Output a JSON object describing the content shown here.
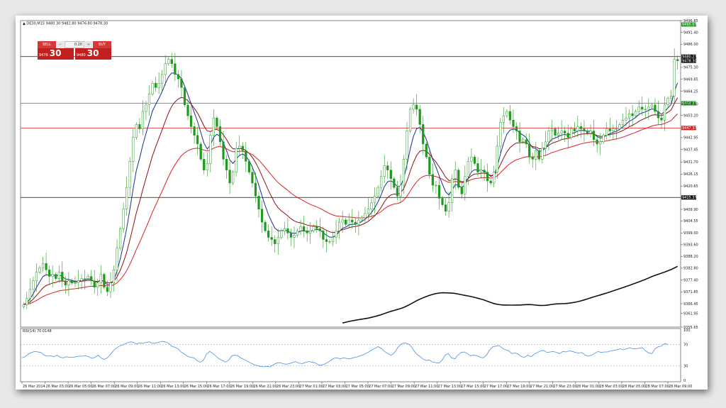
{
  "header": {
    "symbol_line": "▲ DE30,M15  9480.30 9482.80 9476.80 9478.30",
    "rsi_label": "RSI(14) 70.0148"
  },
  "trade_panel": {
    "sell_label": "SELL",
    "buy_label": "BUY",
    "lot_value": "0.20",
    "sell_price_small": "9478",
    "sell_price_big": "30",
    "buy_price_small": "9480",
    "buy_price_big": "30"
  },
  "colors": {
    "bull": "#1f9a1f",
    "bear": "#1f9a1f",
    "ma_fast": "#1a2c9c",
    "ma_mid": "#8b1010",
    "ma_slow": "#e02020",
    "ma_long": "#111111",
    "rsi": "#4a90e2"
  },
  "chart_data": {
    "type": "candlestick",
    "title": "DE30,M15",
    "ylim": [
      9355.65,
      9496.85
    ],
    "y_ticks": [
      "9496.85",
      "9491.40",
      "9486.00",
      "9475.30",
      "9469.85",
      "9464.25",
      "9458.30",
      "9453.20",
      "9442.95",
      "9437.45",
      "9431.70",
      "9426.15",
      "9420.65",
      "9409.90",
      "9404.55",
      "9399.00",
      "9393.60",
      "9388.20",
      "9382.80",
      "9377.40",
      "9371.85",
      "9366.45",
      "9361.95",
      "9355.65"
    ],
    "x_ticks": [
      "26 Mar 2014",
      "26 Mar 03:00",
      "26 Mar 05:00",
      "26 Mar 07:00",
      "26 Mar 09:00",
      "26 Mar 11:00",
      "26 Mar 13:00",
      "26 Mar 15:00",
      "26 Mar 17:00",
      "26 Mar 19:00",
      "26 Mar 21:00",
      "26 Mar 23:00",
      "27 Mar 01:00",
      "27 Mar 03:00",
      "27 Mar 05:00",
      "27 Mar 07:00",
      "27 Mar 09:00",
      "27 Mar 11:00",
      "27 Mar 13:00",
      "27 Mar 15:00",
      "27 Mar 17:00",
      "27 Mar 19:00",
      "27 Mar 21:00",
      "27 Mar 23:00",
      "28 Mar 01:00",
      "28 Mar 03:00",
      "28 Mar 05:00",
      "28 Mar 07:00",
      "28 Mar 09:00"
    ],
    "levels": [
      {
        "label": "9480.27",
        "value": 9480.27,
        "color": "#111111"
      },
      {
        "label": "9478.30",
        "value": 9478.3,
        "color": "#111111",
        "box_only": true
      },
      {
        "label": "9458.77",
        "value": 9458.77,
        "color": "#1f9a1f"
      },
      {
        "label": "9447.37",
        "value": 9447.37,
        "color": "#d42020"
      },
      {
        "label": "9415.37",
        "value": 9415.37,
        "color": "#111111"
      },
      {
        "label": "9495.07",
        "value": 9495.07,
        "color": "#1f9a1f",
        "box_only": true
      }
    ],
    "closes": [
      9366,
      9369,
      9373,
      9377,
      9381,
      9383,
      9385,
      9382,
      9379,
      9380,
      9378,
      9381,
      9377,
      9375,
      9377,
      9376,
      9376,
      9377,
      9378,
      9378,
      9379,
      9377,
      9374,
      9376,
      9380,
      9374,
      9372,
      9376,
      9382,
      9392,
      9401,
      9410,
      9420,
      9432,
      9443,
      9449,
      9447,
      9455,
      9458,
      9463,
      9468,
      9466,
      9468,
      9472,
      9477,
      9479,
      9477,
      9472,
      9470,
      9466,
      9458,
      9453,
      9448,
      9444,
      9440,
      9433,
      9428,
      9431,
      9444,
      9452,
      9448,
      9441,
      9433,
      9428,
      9422,
      9427,
      9438,
      9439,
      9437,
      9432,
      9427,
      9422,
      9416,
      9410,
      9404,
      9400,
      9397,
      9396,
      9394,
      9397,
      9400,
      9401,
      9399,
      9397,
      9398,
      9400,
      9402,
      9400,
      9399,
      9400,
      9402,
      9401,
      9400,
      9396,
      9395,
      9395,
      9397,
      9400,
      9404,
      9405,
      9403,
      9405,
      9404,
      9403,
      9405,
      9406,
      9408,
      9410,
      9413,
      9416,
      9420,
      9425,
      9430,
      9428,
      9424,
      9420,
      9416,
      9421,
      9433,
      9446,
      9456,
      9458,
      9456,
      9449,
      9440,
      9434,
      9426,
      9421,
      9421,
      9415,
      9412,
      9409,
      9413,
      9424,
      9428,
      9420,
      9417,
      9425,
      9432,
      9434,
      9431,
      9427,
      9428,
      9427,
      9423,
      9422,
      9427,
      9439,
      9450,
      9453,
      9455,
      9451,
      9448,
      9446,
      9441,
      9442,
      9440,
      9434,
      9433,
      9437,
      9433,
      9438,
      9441,
      9446,
      9447,
      9444,
      9445,
      9446,
      9445,
      9443,
      9447,
      9446,
      9448,
      9447,
      9446,
      9445,
      9446,
      9442,
      9440,
      9441,
      9444,
      9447,
      9446,
      9447,
      9447,
      9449,
      9451,
      9452,
      9454,
      9453,
      9455,
      9457,
      9456,
      9456,
      9457,
      9458,
      9455,
      9452,
      9451,
      9458,
      9461,
      9462,
      9479,
      9478.3
    ],
    "rsi": [
      45,
      47,
      52,
      55,
      57,
      56,
      55,
      50,
      48,
      49,
      47,
      50,
      46,
      45,
      47,
      46,
      46,
      47,
      48,
      48,
      49,
      47,
      44,
      46,
      50,
      44,
      42,
      46,
      53,
      60,
      65,
      68,
      70,
      73,
      75,
      74,
      71,
      73,
      72,
      74,
      75,
      72,
      73,
      74,
      76,
      75,
      73,
      67,
      65,
      62,
      56,
      52,
      48,
      46,
      45,
      40,
      37,
      40,
      52,
      57,
      53,
      48,
      43,
      40,
      37,
      41,
      49,
      50,
      48,
      44,
      41,
      38,
      35,
      32,
      30,
      29,
      28,
      29,
      28,
      32,
      35,
      36,
      34,
      33,
      34,
      36,
      38,
      35,
      34,
      36,
      38,
      37,
      36,
      32,
      31,
      33,
      36,
      40,
      44,
      45,
      43,
      45,
      44,
      43,
      45,
      46,
      48,
      50,
      53,
      56,
      60,
      63,
      66,
      62,
      57,
      53,
      50,
      54,
      63,
      70,
      73,
      72,
      69,
      60,
      52,
      48,
      43,
      40,
      41,
      37,
      36,
      35,
      40,
      50,
      53,
      45,
      43,
      50,
      55,
      56,
      53,
      49,
      50,
      49,
      46,
      45,
      50,
      60,
      66,
      67,
      68,
      63,
      60,
      58,
      53,
      54,
      52,
      47,
      46,
      50,
      47,
      52,
      55,
      58,
      59,
      55,
      56,
      57,
      55,
      53,
      57,
      56,
      58,
      57,
      55,
      54,
      55,
      50,
      48,
      50,
      53,
      57,
      55,
      56,
      56,
      58,
      59,
      60,
      62,
      60,
      62,
      64,
      62,
      62,
      63,
      64,
      58,
      54,
      53,
      62,
      66,
      67,
      72,
      70
    ]
  }
}
